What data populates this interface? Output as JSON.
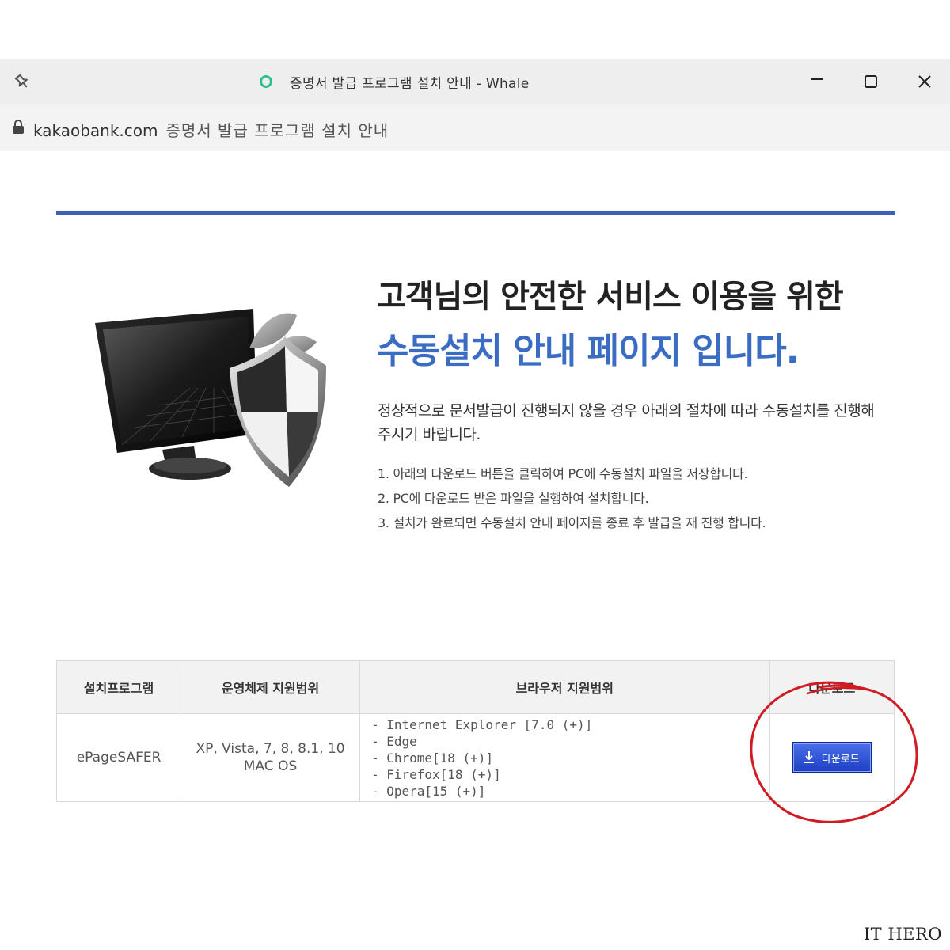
{
  "window": {
    "title": "증명서 발급 프로그램 설치 안내 - Whale",
    "pin_icon": "pin-icon",
    "loading_icon": "loading-ring-icon",
    "controls": [
      "minimize-icon",
      "maximize-icon",
      "close-icon"
    ]
  },
  "address_bar": {
    "lock_icon": "lock-icon",
    "domain": "kakaobank.com",
    "page_title": "증명서 발급 프로그램 설치 안내"
  },
  "colors": {
    "accent_blue": "#3b6cc4",
    "rule_blue": "#3d5fb8",
    "button_blue": "#2a4fd6",
    "annotation_red": "#d01b23",
    "loader_green": "#2ec28a"
  },
  "main": {
    "heading_line1": "고객님의 안전한 서비스 이용을 위한",
    "heading_line2": "수동설치 안내 페이지 입니다.",
    "intro": "정상적으로 문서발급이 진행되지 않을 경우 아래의 절차에 따라 수동설치를 진행해 주시기 바랍니다.",
    "steps": [
      "1. 아래의 다운로드 버튼을 클릭하여 PC에 수동설치 파일을 저장합니다.",
      "2. PC에 다운로드 받은 파일을 실행하여 설치합니다.",
      "3. 설치가 완료되면 수동설치 안내 페이지를 종료 후 발급을 재 진행 합니다."
    ]
  },
  "table": {
    "headers": [
      "설치프로그램",
      "운영체제 지원범위",
      "브라우저 지원범위",
      "다운로드"
    ],
    "row": {
      "program": "ePageSAFER",
      "os_line1": "XP, Vista, 7, 8, 8.1, 10",
      "os_line2": "MAC OS",
      "browsers": [
        "- Internet Explorer [7.0 (+)]",
        "- Edge",
        "- Chrome[18 (+)]",
        "- Firefox[18 (+)]",
        "- Opera[15 (+)]"
      ],
      "download_label": "다운로드",
      "download_icon": "download-icon"
    }
  },
  "watermark": "IT HERO"
}
